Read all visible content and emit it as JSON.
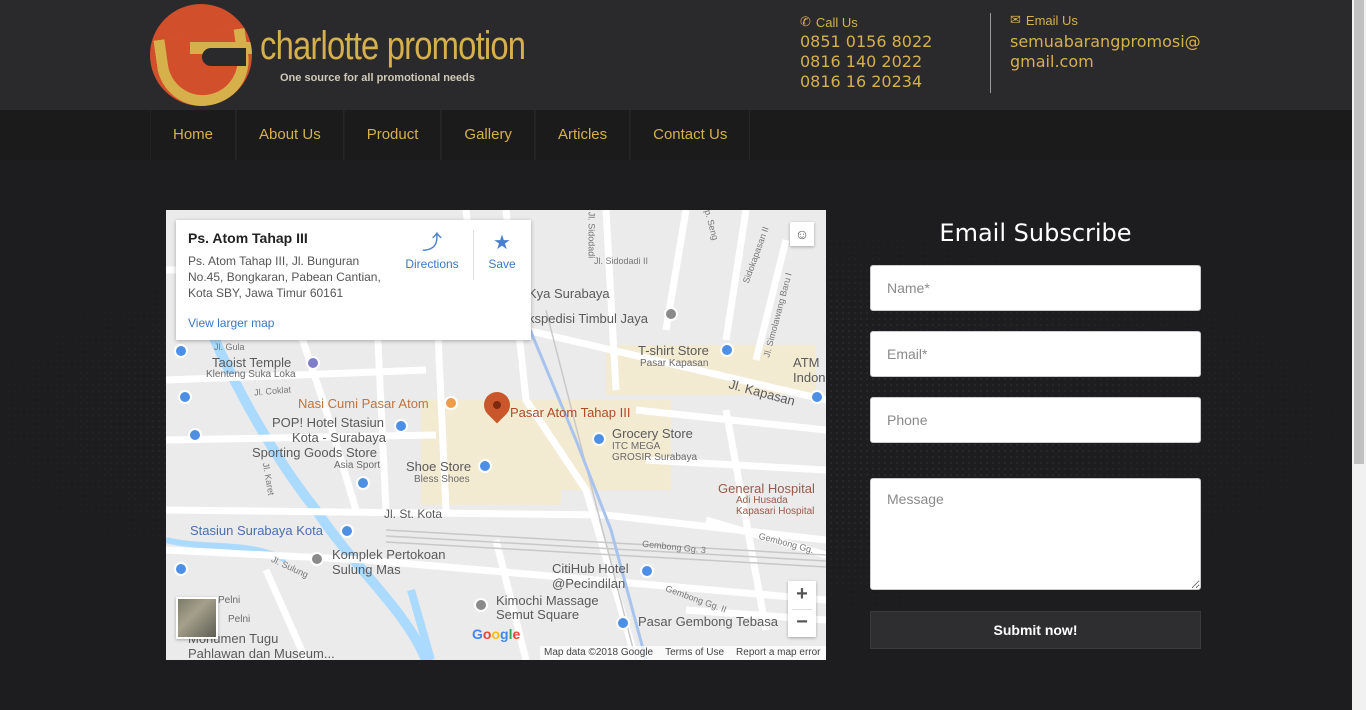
{
  "brand": {
    "name": "charlotte promotion",
    "tagline": "One source for all  promotional needs",
    "accent": "#d6b04a"
  },
  "contact": {
    "call_label": "Call Us",
    "phones": [
      "0851 0156 8022",
      "0816 140 2022",
      "0816 16 20234"
    ],
    "email_label": "Email Us",
    "email": "semuabarangpromosi@gmail.com"
  },
  "nav": {
    "items": [
      "Home",
      "About Us",
      "Product",
      "Gallery",
      "Articles",
      "Contact Us"
    ]
  },
  "map": {
    "place_title": "Ps. Atom Tahap III",
    "address": "Ps. Atom Tahap III, Jl. Bunguran No.45, Bongkaran, Pabean Cantian, Kota SBY, Jawa Timur 60161",
    "view_larger": "View larger map",
    "directions_label": "Directions",
    "save_label": "Save",
    "zoom_in": "+",
    "zoom_out": "−",
    "google_logo": "Google",
    "footer": [
      "Map data ©2018 Google",
      "Terms of Use",
      "Report a map error"
    ],
    "labels": {
      "pasar_atom": "Pasar Atom Tahap III",
      "nasi_cumi": "Nasi Cumi Pasar Atom",
      "taoist": "Taoist Temple",
      "klenteng": "Klenteng Suka Loka",
      "pop_hotel": "POP! Hotel Stasiun",
      "pop_hotel2": "Kota - Surabaya",
      "sporting": "Sporting Goods Store",
      "asia_sport": "Asia Sport",
      "shoe": "Shoe Store",
      "bless": "Bless Shoes",
      "grocery": "Grocery Store",
      "itc": "ITC MEGA",
      "grosir": "GROSIR Surabaya",
      "tshirt": "T-shirt Store",
      "pasar_kapasan": "Pasar Kapasan",
      "kya": "Kya Surabaya",
      "ekspedisi": "kspedisi Timbul Jaya",
      "jl_kapasan": "Jl. Kapasan",
      "atm": "ATM",
      "indon": "Indon",
      "general_hospital": "General Hospital",
      "adi_husada": "Adi Husada",
      "kapasari": "Kapasari Hospital",
      "stasiun": "Stasiun Surabaya Kota",
      "komplek": "Komplek Pertokoan",
      "sulung": "Sulung Mas",
      "citihub": "CitiHub Hotel",
      "pecindilan": "@Pecindilan",
      "kimochi": "Kimochi Massage",
      "semut": "Semut Square",
      "pasar_gembong": "Pasar Gembong Tebasa",
      "monumen": "Monumen Tugu",
      "pahlawan": "Pahlawan dan Museum...",
      "pelni1": "Pelni",
      "pelni2": "Pelni",
      "jl_st_kota": "Jl. St. Kota",
      "jl_gula": "Jl. Gula",
      "jl_coklat": "Jl. Coklat",
      "jl_karet": "Jl. Karet",
      "jl_sulung": "Jl. Sulung",
      "gembong3": "Gembong Gg. 3",
      "gembong2": "Gembong Gg. II",
      "gembong_gg": "Gembong Gg.",
      "sidodadi": "Jl. Sidodadi II",
      "sidodadi_v": "Jl. Sidodadi",
      "sidokapasan": "Sidokapasan II",
      "simolawang": "Jl. Simolawang Baru I",
      "kapasan_seng": "p. Seng"
    }
  },
  "subscribe": {
    "title": "Email Subscribe",
    "name_placeholder": "Name*",
    "email_placeholder": "Email*",
    "phone_placeholder": "Phone",
    "message_placeholder": "Message",
    "submit_label": "Submit now!"
  }
}
